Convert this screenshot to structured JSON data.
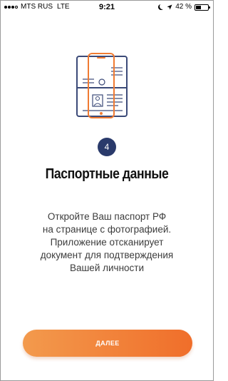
{
  "status_bar": {
    "carrier": "MTS RUS",
    "network": "LTE",
    "time": "9:21",
    "battery_percent": "42 %",
    "battery_level": 0.42
  },
  "onboarding": {
    "step_number": "4",
    "title": "Паспортные данные",
    "description_lines": [
      "Откройте Ваш паспорт РФ",
      "на странице с фотографией.",
      "Приложение отсканирует",
      "документ для подтверждения",
      "Вашей личности"
    ],
    "next_button_label": "ДАЛЕЕ"
  },
  "colors": {
    "accent": "#f07b32",
    "badge": "#2a3a6b",
    "passport_outline": "#3b4a78"
  },
  "icons": {
    "illustration": "passport-scan-icon"
  }
}
